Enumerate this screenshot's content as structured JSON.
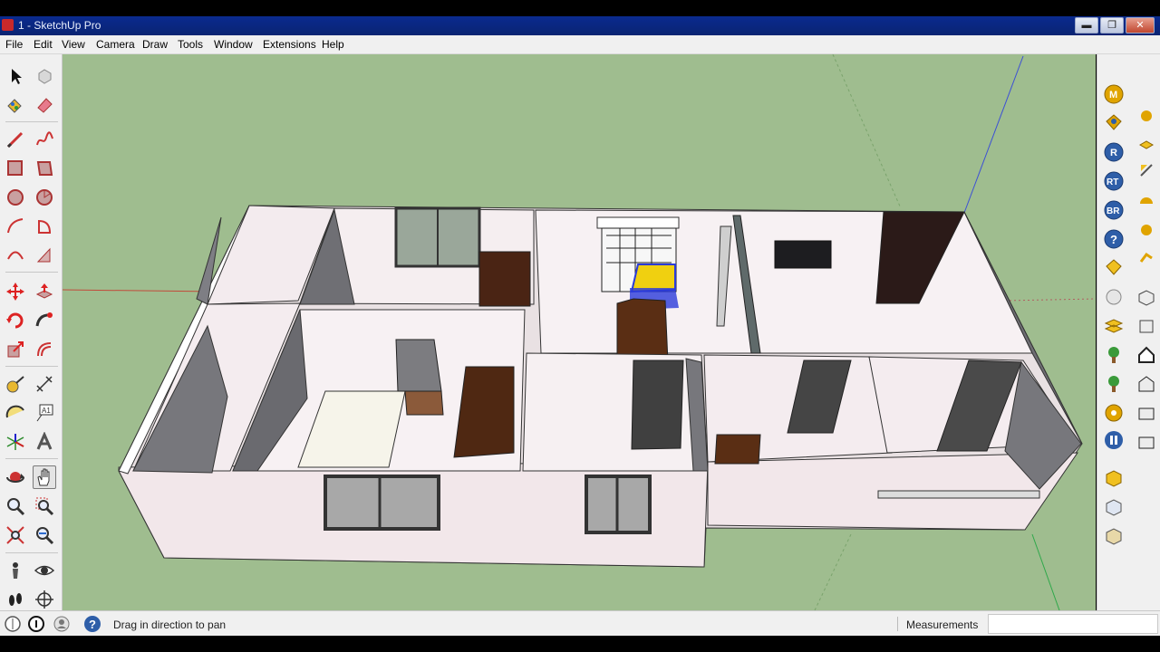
{
  "window": {
    "title": "1 - SketchUp Pro",
    "min_glyph": "▬",
    "max_glyph": "❐",
    "close_glyph": "✕"
  },
  "menu": [
    "File",
    "Edit",
    "View",
    "Camera",
    "Draw",
    "Tools",
    "Window",
    "Extensions",
    "Help"
  ],
  "left_toolbar": [
    "select-tool",
    "make-component-tool",
    "paint-bucket-tool",
    "eraser-tool",
    "line-tool",
    "freehand-tool",
    "rectangle-tool",
    "rotated-rectangle-tool",
    "circle-tool",
    "polygon-tool",
    "arc-tool",
    "pie-tool",
    "three-point-arc-tool",
    "two-point-arc-tool",
    "move-tool",
    "push-pull-tool",
    "rotate-tool",
    "follow-me-tool",
    "scale-tool",
    "offset-tool",
    "tape-measure-tool",
    "dimension-tool",
    "protractor-tool",
    "text-tool",
    "axes-tool",
    "3d-text-tool",
    "orbit-tool",
    "pan-tool",
    "zoom-tool",
    "zoom-window-tool",
    "zoom-extents-tool",
    "previous-view-tool",
    "position-camera-tool",
    "look-around-tool",
    "walk-tool",
    "section-plane-tool"
  ],
  "right_toolbar": {
    "render_buttons": [
      {
        "label": "M",
        "color": "#e0a400"
      },
      {
        "label": "",
        "color": "#e0a400"
      },
      {
        "label": "R",
        "color": "#2e5ea8"
      },
      {
        "label": "RT",
        "color": "#2e5ea8"
      },
      {
        "label": "BR",
        "color": "#2e5ea8"
      },
      {
        "label": "?",
        "color": "#2e5ea8"
      }
    ],
    "badge_labels": {
      "m": "M",
      "r": "R",
      "rt": "RT",
      "br": "BR",
      "help": "?"
    }
  },
  "status": {
    "message": "Drag in direction to pan",
    "measurements_label": "Measurements",
    "measurements_value": ""
  },
  "colors": {
    "sky_ground": "#9fbd8f",
    "wall_face": "#f3e9ec",
    "wall_top": "#ffffff",
    "floor": "#e8e3e4",
    "shadow_wall": "#7f7f84",
    "door": "#3d3d3d",
    "wood": "#5a2e14",
    "accent_selection": "#2a3bd9"
  }
}
